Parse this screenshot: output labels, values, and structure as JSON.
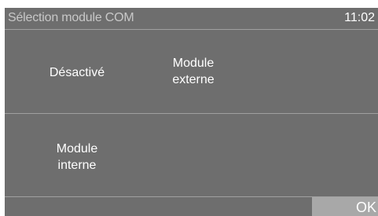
{
  "header": {
    "title": "Sélection module COM",
    "time": "11:02"
  },
  "options": {
    "desactive": "Désactivé",
    "externe_line1": "Module",
    "externe_line2": "externe",
    "interne_line1": "Module",
    "interne_line2": "interne"
  },
  "footer": {
    "ok_label": "OK"
  },
  "colors": {
    "background": "#6e6e6e",
    "divider": "#a0a0a0",
    "ok_button": "#a8a8a8",
    "title_text": "#c8c8c8"
  }
}
